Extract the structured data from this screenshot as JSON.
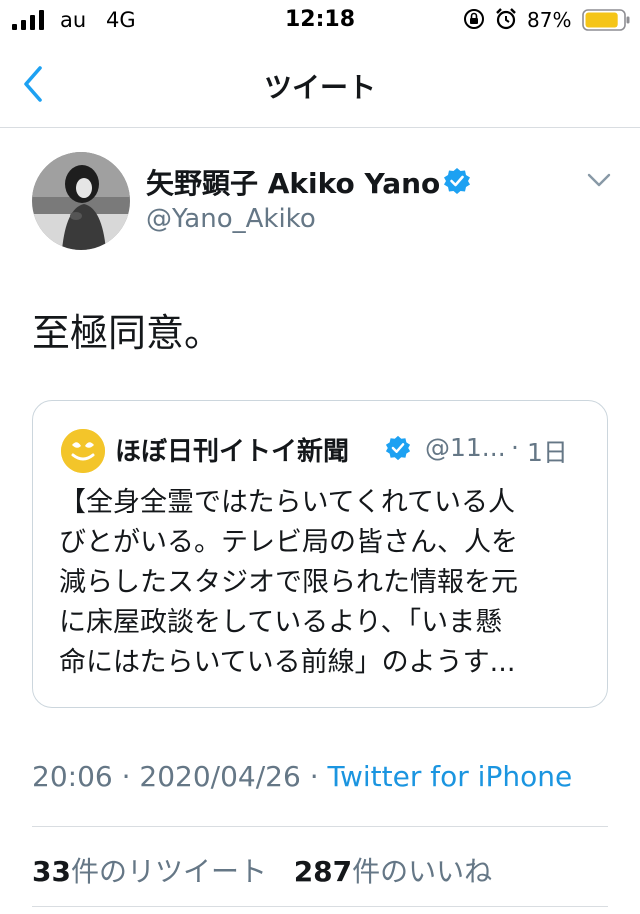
{
  "status_bar": {
    "carrier": "au",
    "network": "4G",
    "time": "12:18",
    "battery_percent": "87%",
    "battery_level": 0.87,
    "signal_bars": 4
  },
  "nav": {
    "title": "ツイート",
    "back_icon": "chevron-left-icon"
  },
  "tweet": {
    "author_name": "矢野顕子 Akiko Yano",
    "handle": "@Yano_Akiko",
    "text": "至極同意。",
    "verified": true
  },
  "quoted_tweet": {
    "author_name": "ほぼ日刊イトイ新聞",
    "handle": "@11...",
    "separator": "·",
    "time": "1日",
    "lines": [
      "【全身全霊ではたらいてくれている人",
      "びとがいる。テレビ局の皆さん、人を",
      "減らしたスタジオで限られた情報を元",
      "に床屋政談をしているより、「いま懸",
      "命にはたらいている前線」のようす..."
    ]
  },
  "meta": {
    "time": "20:06",
    "date": "2020/04/26",
    "separator": "·",
    "source": "Twitter for iPhone"
  },
  "stats": {
    "retweets_count": "33",
    "retweets_label": "件のリツイート",
    "likes_count": "287",
    "likes_label": "件のいいね"
  },
  "colors": {
    "accent": "#1da1f2",
    "link": "#1b95e0",
    "secondary_text": "#657786",
    "battery_fill": "#f5c518"
  }
}
